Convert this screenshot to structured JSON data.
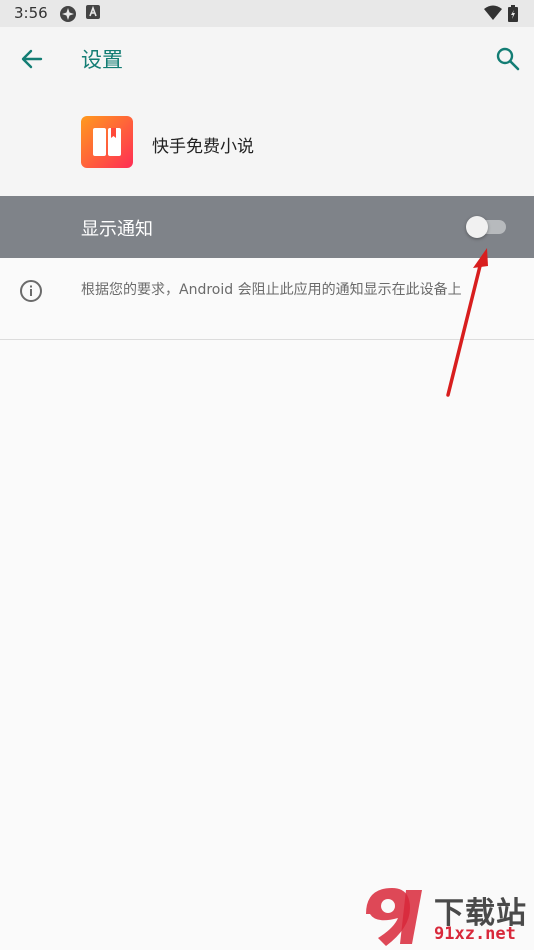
{
  "status_bar": {
    "time": "3:56"
  },
  "app_bar": {
    "title": "设置"
  },
  "app": {
    "name": "快手免费小说"
  },
  "notification_toggle": {
    "label": "显示通知",
    "enabled": false
  },
  "info": {
    "text": "根据您的要求，Android 会阻止此应用的通知显示在此设备上"
  },
  "watermark": {
    "top": "下载站",
    "bottom": "91xz.net"
  },
  "colors": {
    "accent": "#137d74",
    "toggle_row_bg": "#7f8389",
    "annotation_arrow": "#d81e1e"
  }
}
